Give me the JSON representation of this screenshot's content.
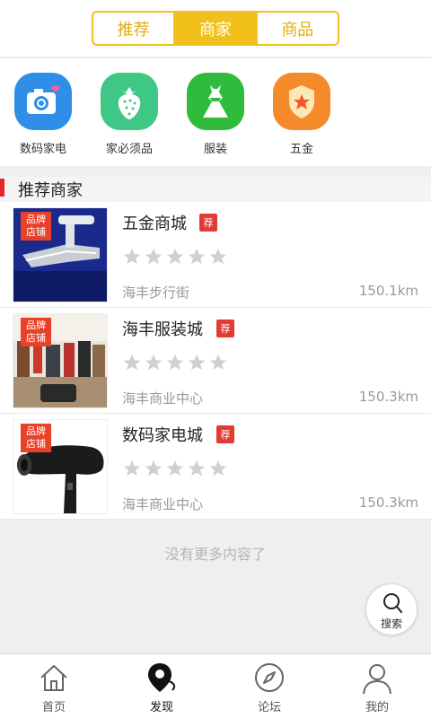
{
  "top_tabs": [
    "推荐",
    "商家",
    "商品"
  ],
  "categories": [
    {
      "label": "数码家电",
      "icon": "camera-icon",
      "color": "#2f8fe8"
    },
    {
      "label": "家必须品",
      "icon": "strawberry-icon",
      "color": "#3ec785"
    },
    {
      "label": "服装",
      "icon": "dress-icon",
      "color": "#2fbb3c"
    },
    {
      "label": "五金",
      "icon": "shield-star-icon",
      "color": "#f58a2b"
    }
  ],
  "section": {
    "title": "推荐商家"
  },
  "brand_tag": "品牌店铺",
  "recommend_badge": "荐",
  "merchants": [
    {
      "name": "五金商城",
      "address": "海丰步行街",
      "distance": "150.1km",
      "rating": 0
    },
    {
      "name": "海丰服装城",
      "address": "海丰商业中心",
      "distance": "150.3km",
      "rating": 0
    },
    {
      "name": "数码家电城",
      "address": "海丰商业中心",
      "distance": "150.3km",
      "rating": 0
    }
  ],
  "no_more_text": "没有更多内容了",
  "search_fab": {
    "label": "搜索"
  },
  "bottom_nav": [
    {
      "label": "首页",
      "icon": "home-icon"
    },
    {
      "label": "发现",
      "icon": "location-pin-icon"
    },
    {
      "label": "论坛",
      "icon": "compass-icon"
    },
    {
      "label": "我的",
      "icon": "user-icon"
    }
  ]
}
